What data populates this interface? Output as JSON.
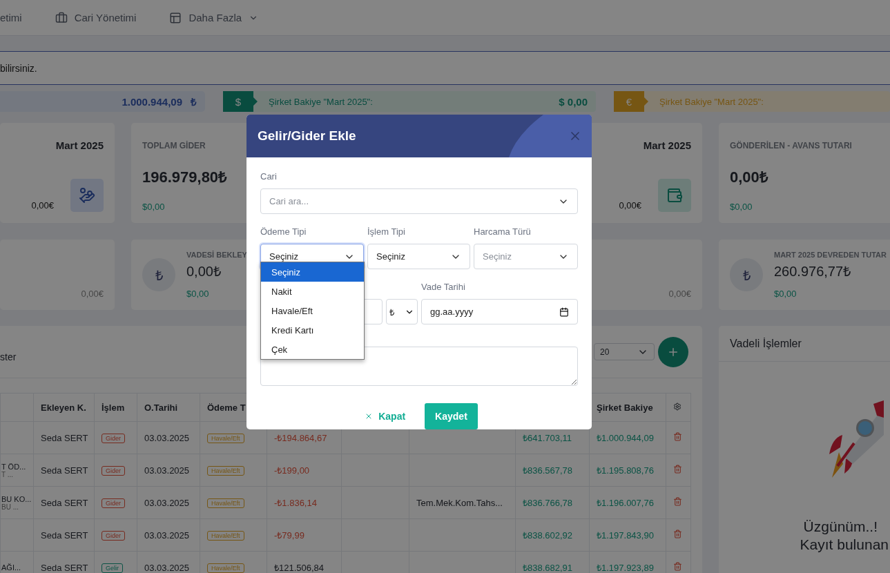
{
  "nav": [
    {
      "label": "etimi",
      "has_menu": false
    },
    {
      "label": "Cari Yönetimi",
      "has_menu": false
    },
    {
      "label": "Daha Fazla",
      "has_menu": true
    }
  ],
  "notice": "bilirsiniz.",
  "balances": [
    {
      "kind": "total",
      "amount": "1.000.944,09",
      "currency": "₺"
    },
    {
      "kind": "usd",
      "symbol": "$",
      "label": "Şirket Bakiye \"Mart 2025\":",
      "amount": "$ 0,00"
    },
    {
      "kind": "eur",
      "symbol": "€",
      "label": "Şirket Bakiye \"Mart 2025\":"
    }
  ],
  "cards_top": [
    {
      "kind": "period",
      "period": "Mart 2025",
      "eur": "0,00€"
    },
    {
      "kind": "total",
      "title": "TOPLAM GİDER",
      "amount": "196.979,80₺",
      "usd": "$0,00"
    },
    {
      "kind": "period",
      "period": "Mart 2025",
      "eur": "0,00€"
    },
    {
      "kind": "total",
      "title": "GÖNDERİLEN - AVANS TUTARI",
      "amount": "0,00₺",
      "usd": "$0,00"
    }
  ],
  "cards_bottom": [
    {
      "kind": "plain",
      "eur": "0,00€"
    },
    {
      "kind": "circle",
      "symbol": "₺",
      "title": "VADESİ BEKLEY",
      "amount": "0,00₺",
      "usd": "$0,00"
    },
    {
      "kind": "plain",
      "eur": "0,00€"
    },
    {
      "kind": "circle",
      "symbol": "₺",
      "title": "MART 2025 DEVREDEN TUTAR",
      "amount": "260.976,77₺",
      "usd": "$0,00"
    }
  ],
  "table_panel": {
    "title": "ster",
    "page_size": "20"
  },
  "table": {
    "columns": [
      "Ekleyen K.",
      "İşlem",
      "O.Tarihi",
      "Ödeme T",
      "Şirket Bakiye"
    ],
    "rows": [
      {
        "user": "Seda SERT",
        "type": {
          "label": "Gider",
          "kind": "expense"
        },
        "date": "03.03.2025",
        "payment": "Havale/Eft",
        "column_6": {
          "text": "-₺194.864,67",
          "kind": "negative"
        },
        "column_9": "₺641.703,11",
        "company_balance": "₺1.000.944,09"
      },
      {
        "column_1": [
          "T ÖD...",
          "T ..."
        ],
        "user": "Seda SERT",
        "type": {
          "label": "Gider",
          "kind": "expense"
        },
        "date": "03.03.2025",
        "payment": "Havale/Eft",
        "column_6": {
          "text": "-₺199,00",
          "kind": "negative"
        },
        "column_9": "₺836.567,78",
        "company_balance": "₺1.195.808,76"
      },
      {
        "column_1": [
          "BU KO...",
          "BU ..."
        ],
        "user": "Seda SERT",
        "type": {
          "label": "Gider",
          "kind": "expense"
        },
        "date": "03.03.2025",
        "payment": "Havale/Eft",
        "column_6": {
          "text": "-₺1.836,14",
          "kind": "negative"
        },
        "column_8": "Tem.Mek.Kom.Tahs...",
        "column_9": "₺836.766,78",
        "company_balance": "₺1.196.007,76"
      },
      {
        "user": "Seda SERT",
        "type": {
          "label": "Gider",
          "kind": "expense"
        },
        "date": "03.03.2025",
        "payment": "Havale/Eft",
        "column_6": {
          "text": "-₺79,99",
          "kind": "negative"
        },
        "column_9": "₺838.602,92",
        "company_balance": "₺1.197.843,90"
      },
      {
        "column_1": [
          "AĞI..."
        ],
        "user": "Seda SERT",
        "type": {
          "label": "Gelir",
          "kind": "income"
        },
        "date": "03.03.2025",
        "payment": "Havale/Eft",
        "column_6": {
          "text": "₺121.506,84",
          "kind": "positive"
        },
        "column_9": "₺838.682,91",
        "company_balance": "₺1.197.923,89"
      }
    ]
  },
  "side_panel": {
    "title": "Vadeli İşlemler",
    "empty_title": "Üzgünüm..!",
    "empty_text": "Kayıt bulunan"
  },
  "modal": {
    "title": "Gelir/Gider Ekle",
    "cari": {
      "label": "Cari",
      "placeholder": "Cari ara..."
    },
    "selects": [
      {
        "label": "Ödeme Tipi",
        "value": "Seçiniz",
        "focused": true
      },
      {
        "label": "İşlem Tipi",
        "value": "Seçiniz",
        "focused": false
      },
      {
        "label": "Harcama Türü",
        "placeholder": "Seçiniz",
        "focused": false
      }
    ],
    "currency": "₺",
    "due_date": {
      "label": "Vade Tarihi",
      "placeholder": "gg.aa.yyyy"
    },
    "options": [
      {
        "label": "Seçiniz",
        "selected": true
      },
      {
        "label": "Nakit",
        "selected": false
      },
      {
        "label": "Havale/Eft",
        "selected": false
      },
      {
        "label": "Kredi Kartı",
        "selected": false
      },
      {
        "label": "Çek",
        "selected": false
      }
    ],
    "cancel": "Kapat",
    "save": "Kaydet"
  }
}
